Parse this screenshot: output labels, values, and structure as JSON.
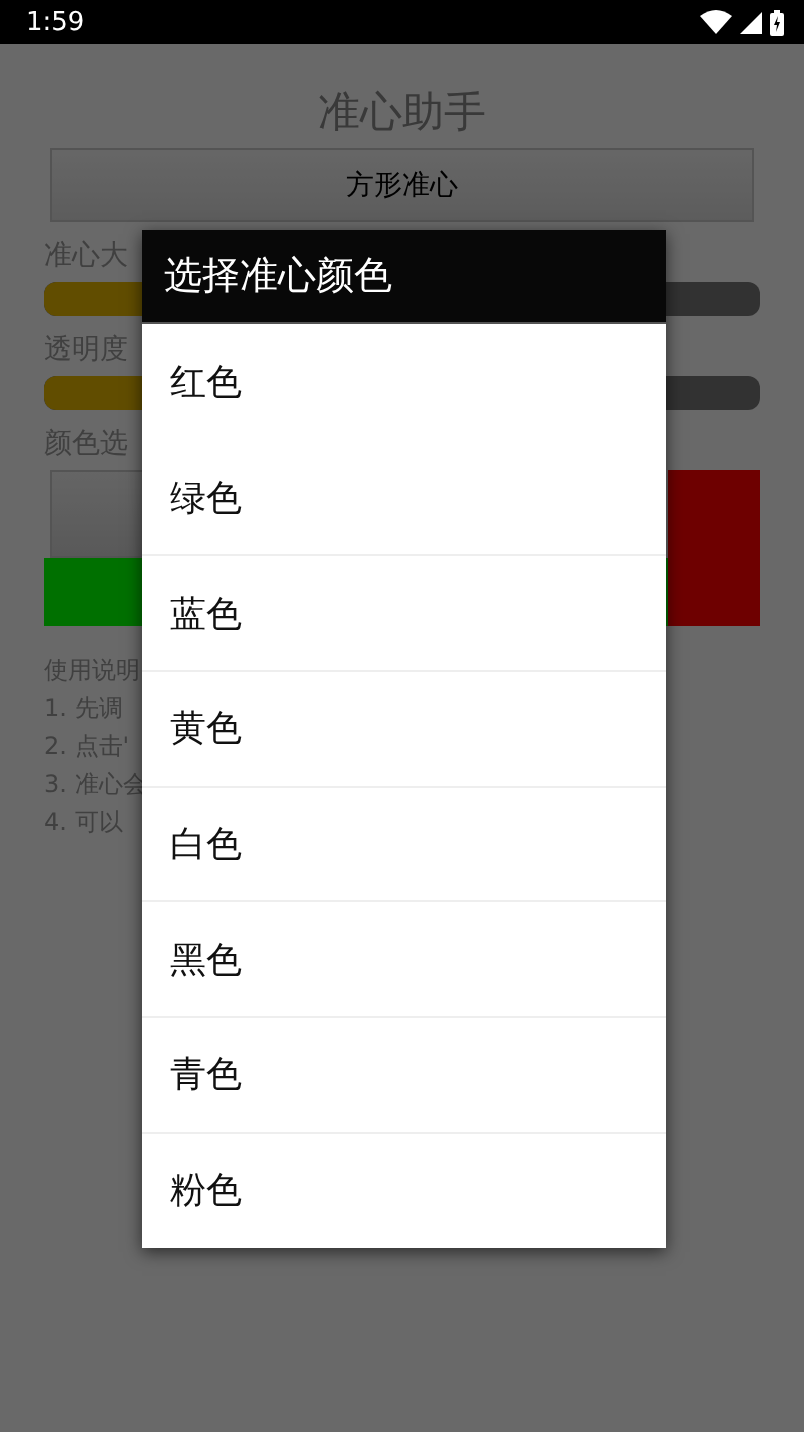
{
  "status_bar": {
    "time": "1:59"
  },
  "app": {
    "title": "准心助手",
    "shape_button": "方形准心",
    "size_label": "准心大",
    "size_slider": {
      "level": 0.3
    },
    "opacity_label": "透明度",
    "opacity_slider": {
      "level": 0.3
    },
    "color_label": "颜色选",
    "swatches": [
      {
        "color": "#007000"
      },
      {
        "color": "#6e0000"
      }
    ],
    "instructions": [
      "使用说明",
      "1. 先调",
      "2. 点击'",
      "3. 准心会",
      "4. 可以"
    ]
  },
  "dialog": {
    "title": "选择准心颜色",
    "options": [
      {
        "label": "红色"
      },
      {
        "label": "绿色"
      },
      {
        "label": "蓝色"
      },
      {
        "label": "黄色"
      },
      {
        "label": "白色"
      },
      {
        "label": "黑色"
      },
      {
        "label": "青色"
      },
      {
        "label": "粉色"
      }
    ]
  }
}
